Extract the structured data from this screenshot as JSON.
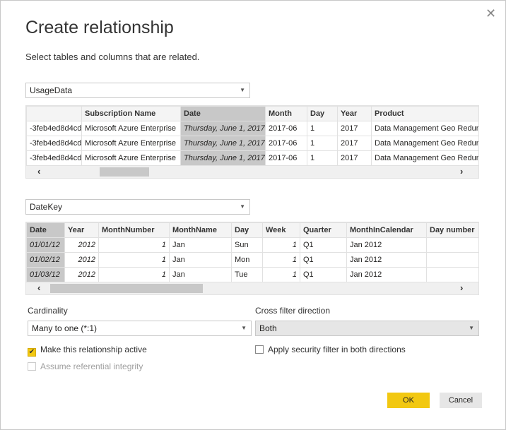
{
  "dialog": {
    "title": "Create relationship",
    "subtitle": "Select tables and columns that are related."
  },
  "table1": {
    "name": "UsageData",
    "headers": [
      "",
      "Subscription Name",
      "Date",
      "Month",
      "Day",
      "Year",
      "Product"
    ],
    "rows": [
      [
        "-3feb4ed8d4cd",
        "Microsoft Azure Enterprise",
        "Thursday, June 1, 2017",
        "2017-06",
        "1",
        "2017",
        "Data Management Geo Redun"
      ],
      [
        "-3feb4ed8d4cd",
        "Microsoft Azure Enterprise",
        "Thursday, June 1, 2017",
        "2017-06",
        "1",
        "2017",
        "Data Management Geo Redun"
      ],
      [
        "-3feb4ed8d4cd",
        "Microsoft Azure Enterprise",
        "Thursday, June 1, 2017",
        "2017-06",
        "1",
        "2017",
        "Data Management Geo Redun"
      ]
    ],
    "selected_column": "Date"
  },
  "table2": {
    "name": "DateKey",
    "headers": [
      "Date",
      "Year",
      "MonthNumber",
      "MonthName",
      "Day",
      "Week",
      "Quarter",
      "MonthInCalendar",
      "Day number"
    ],
    "rows": [
      [
        "01/01/12",
        "2012",
        "1",
        "Jan",
        "Sun",
        "1",
        "Q1",
        "Jan 2012",
        ""
      ],
      [
        "01/02/12",
        "2012",
        "1",
        "Jan",
        "Mon",
        "1",
        "Q1",
        "Jan 2012",
        ""
      ],
      [
        "01/03/12",
        "2012",
        "1",
        "Jan",
        "Tue",
        "1",
        "Q1",
        "Jan 2012",
        ""
      ]
    ],
    "selected_column": "Date"
  },
  "cardinality": {
    "label": "Cardinality",
    "value": "Many to one (*:1)"
  },
  "cross_filter": {
    "label": "Cross filter direction",
    "value": "Both"
  },
  "options": {
    "active": {
      "label": "Make this relationship active",
      "checked": true
    },
    "security": {
      "label": "Apply security filter in both directions",
      "checked": false
    },
    "integrity": {
      "label": "Assume referential integrity",
      "checked": false,
      "disabled": true
    }
  },
  "buttons": {
    "ok": "OK",
    "cancel": "Cancel"
  },
  "colors": {
    "accent": "#f2c811"
  }
}
